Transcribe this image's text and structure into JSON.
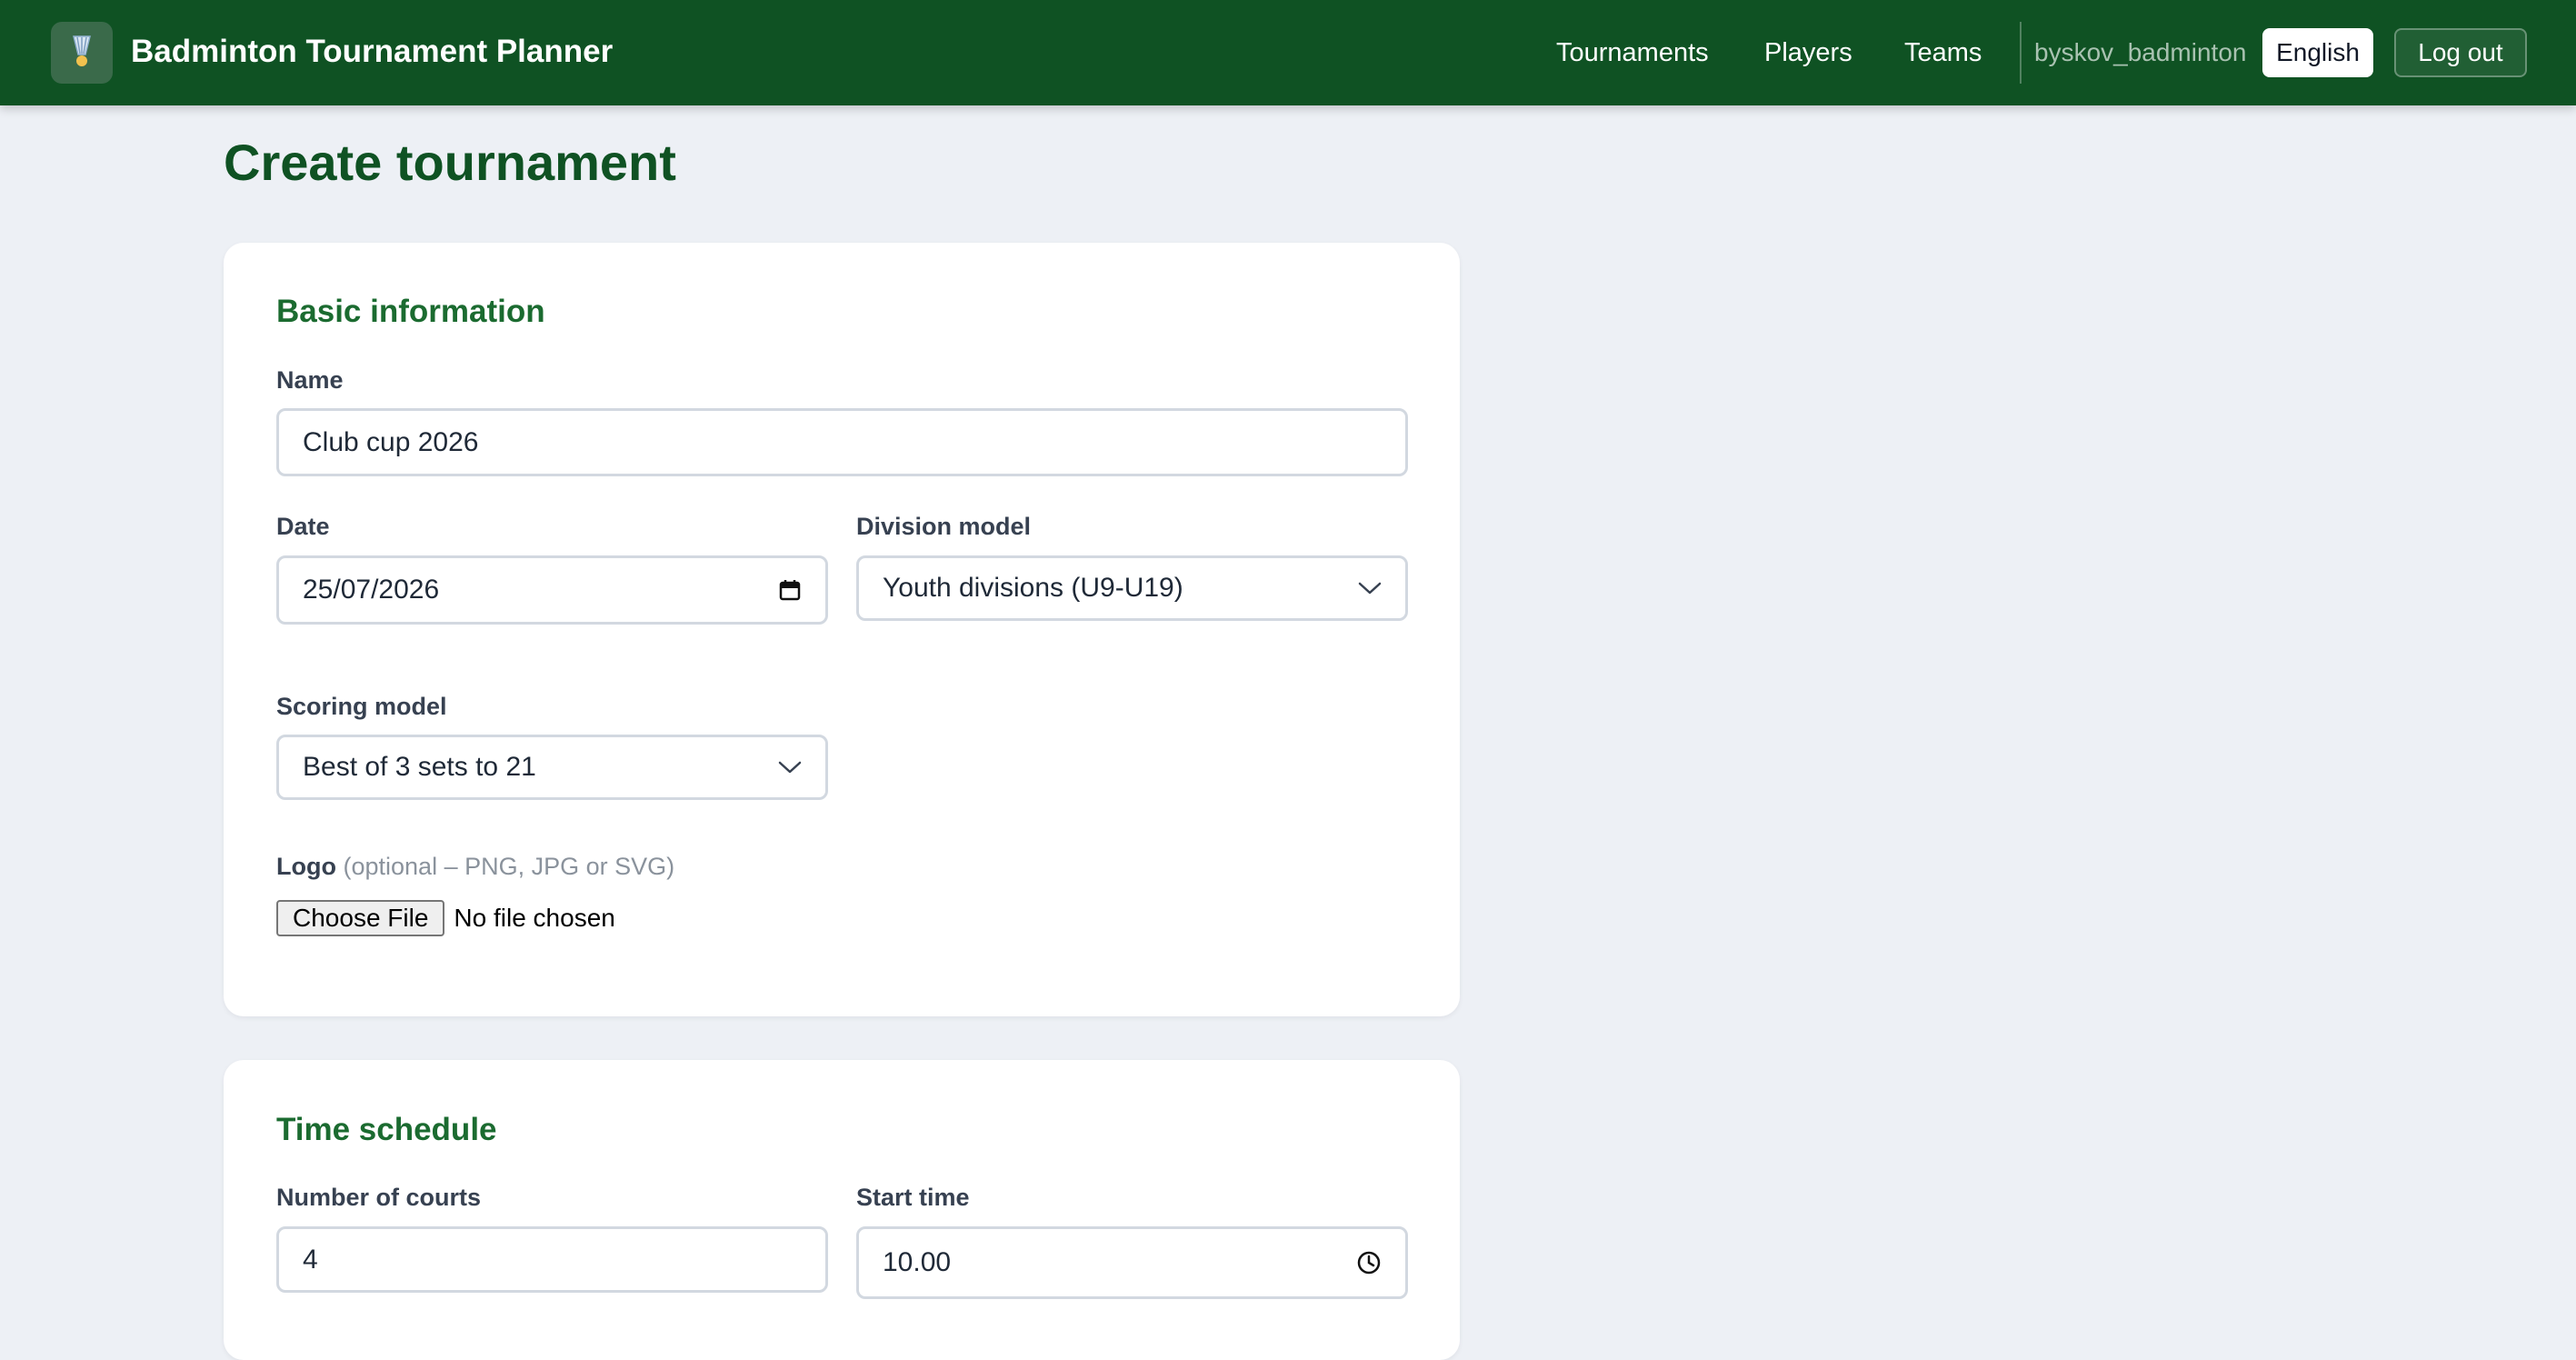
{
  "header": {
    "app_title": "Badminton Tournament Planner",
    "logo_icon": "shuttlecock-icon",
    "nav": {
      "tournaments": "Tournaments",
      "players": "Players",
      "teams": "Teams"
    },
    "username": "byskov_badminton",
    "language": "English",
    "logout": "Log out"
  },
  "page": {
    "title": "Create tournament"
  },
  "basic_info": {
    "heading": "Basic information",
    "name_label": "Name",
    "name_value": "Club cup 2026",
    "date_label": "Date",
    "date_value": "25/07/2026",
    "division_label": "Division model",
    "division_value": "Youth divisions (U9-U19)",
    "scoring_label": "Scoring model",
    "scoring_value": "Best of 3 sets to 21",
    "logo_label": "Logo",
    "logo_hint": "(optional – PNG, JPG or SVG)",
    "file_button": "Choose File",
    "file_status": "No file chosen"
  },
  "time_schedule": {
    "heading": "Time schedule",
    "courts_label": "Number of courts",
    "courts_value": "4",
    "start_label": "Start time",
    "start_value": "10.00"
  },
  "colors": {
    "navbar": "#0f5223",
    "title": "#0f5223",
    "section_heading": "#1b6b30",
    "page_background": "#edf0f5"
  }
}
